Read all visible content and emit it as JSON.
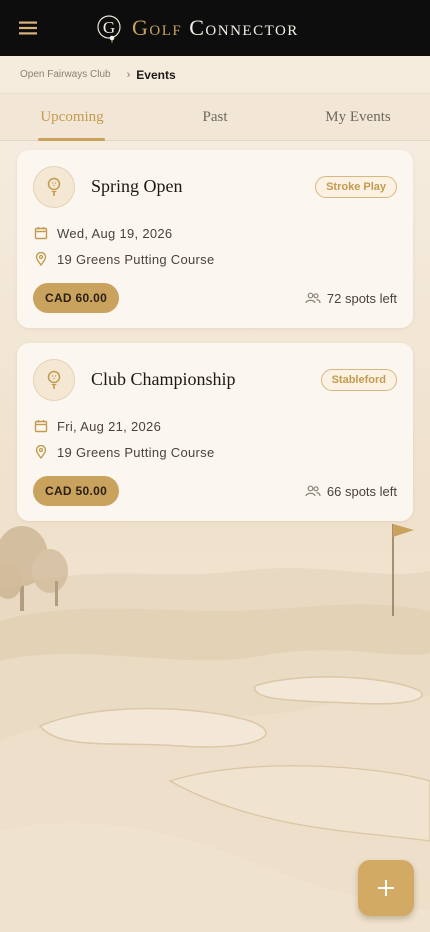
{
  "app": {
    "brand_word1": "Golf",
    "brand_word2": "Connector",
    "logo_letter": "G"
  },
  "breadcrumb": {
    "root": "Open Fairways Club",
    "separator": "›",
    "current": "Events"
  },
  "tabs": [
    {
      "label": "Upcoming",
      "active": true
    },
    {
      "label": "Past",
      "active": false
    },
    {
      "label": "My Events",
      "active": false
    }
  ],
  "events": [
    {
      "title": "Spring Open",
      "format": "Stroke Play",
      "date": "Wed, Aug 19, 2026",
      "location": "19 Greens Putting Course",
      "price": "CAD 60.00",
      "spots": "72 spots left"
    },
    {
      "title": "Club Championship",
      "format": "Stableford",
      "date": "Fri, Aug 21, 2026",
      "location": "19 Greens Putting Course",
      "price": "CAD 50.00",
      "spots": "66 spots left"
    }
  ],
  "icons": {
    "menu": "menu-icon",
    "event": "golf-ball-tee-icon",
    "date": "calendar-icon",
    "location": "map-pin-icon",
    "spots": "people-icon",
    "fab": "plus-icon"
  },
  "colors": {
    "appbar": "#0d0d0d",
    "accent_gold": "#c9a25e",
    "tab_active": "#c49a4f",
    "card_bg": "#fbf7f0",
    "page_bg": "#f4ebdd"
  }
}
